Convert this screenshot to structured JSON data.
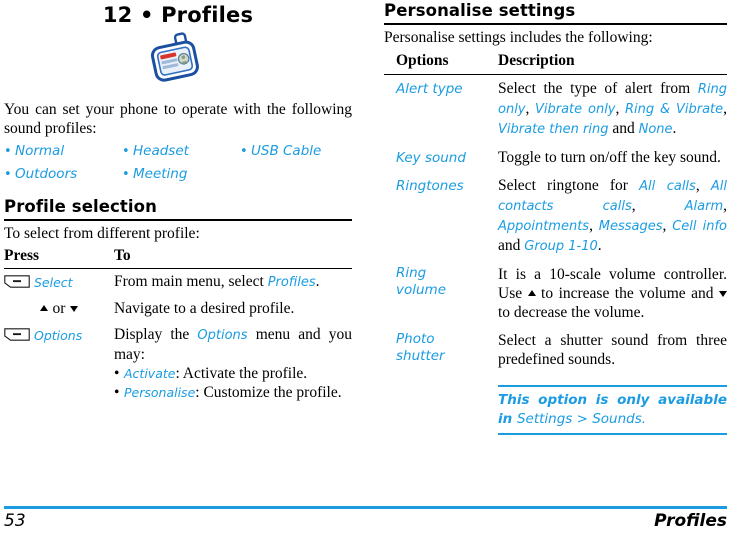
{
  "document": {
    "chapter_title": "12 • Profiles",
    "icon": "id-badge-icon",
    "accent_color": "#1b9ce2",
    "text_color": "#000000"
  },
  "left_column": {
    "intro": "You can set your phone to operate with the following sound profiles:",
    "profiles": [
      [
        "Normal",
        "Headset",
        "USB Cable"
      ],
      [
        "Outdoors",
        "Meeting",
        ""
      ]
    ],
    "section": {
      "heading": "Profile selection",
      "intro": "To select from different profile:",
      "table": {
        "headers": [
          "Press",
          "To"
        ],
        "rows": [
          {
            "press_type": "softkey",
            "press_key_label": "Select",
            "to_prefix": "From main menu, select ",
            "to_blue": "Profiles",
            "to_suffix": "."
          },
          {
            "press_type": "navigate",
            "press_or": "or",
            "to_text": "Navigate to a desired profile."
          },
          {
            "press_type": "softkey",
            "press_key_label": "Options",
            "to_prefix": "Display the ",
            "to_blue": "Options",
            "to_suffix": " menu and you may:",
            "sub_items": [
              {
                "label": "Activate",
                "text": ": Activate the profile."
              },
              {
                "label": "Personalise",
                "text": ": Customize the profile."
              }
            ]
          }
        ]
      }
    }
  },
  "right_column": {
    "heading": "Personalise settings",
    "intro": "Personalise settings includes the following:",
    "table": {
      "headers": [
        "Options",
        "Description"
      ],
      "rows": [
        {
          "option": "Alert type",
          "segments": [
            {
              "t": "Select the type of alert from ",
              "blue": false
            },
            {
              "t": "Ring only",
              "blue": true
            },
            {
              "t": ", ",
              "blue": false
            },
            {
              "t": "Vibrate only",
              "blue": true
            },
            {
              "t": ", ",
              "blue": false
            },
            {
              "t": "Ring & Vibrate",
              "blue": true
            },
            {
              "t": ", ",
              "blue": false
            },
            {
              "t": "Vibrate then ring",
              "blue": true
            },
            {
              "t": " and ",
              "blue": false
            },
            {
              "t": "None",
              "blue": true
            },
            {
              "t": ".",
              "blue": false
            }
          ]
        },
        {
          "option": "Key sound",
          "segments": [
            {
              "t": "Toggle to turn on/off the key sound.",
              "blue": false
            }
          ]
        },
        {
          "option": "Ringtones",
          "segments": [
            {
              "t": "Select ringtone for ",
              "blue": false
            },
            {
              "t": "All calls",
              "blue": true
            },
            {
              "t": ", ",
              "blue": false
            },
            {
              "t": "All contacts calls",
              "blue": true
            },
            {
              "t": ", ",
              "blue": false
            },
            {
              "t": "Alarm",
              "blue": true
            },
            {
              "t": ", ",
              "blue": false
            },
            {
              "t": "Appointments",
              "blue": true
            },
            {
              "t": ", ",
              "blue": false
            },
            {
              "t": "Messages",
              "blue": true
            },
            {
              "t": ", ",
              "blue": false
            },
            {
              "t": "Cell info",
              "blue": true
            },
            {
              "t": " and ",
              "blue": false
            },
            {
              "t": "Group 1-10",
              "blue": true
            },
            {
              "t": ".",
              "blue": false
            }
          ]
        },
        {
          "option": "Ring volume",
          "volume_text_1": "It is a 10-scale volume controller. Use ",
          "volume_text_2": " to increase the volume and ",
          "volume_text_3": " to decrease the volume.",
          "segments": []
        },
        {
          "option": "Photo shutter",
          "segments": [
            {
              "t": "Select a shutter sound from three predefined sounds.",
              "blue": false
            }
          ]
        }
      ]
    },
    "note": {
      "bold_part": "This option is only available in ",
      "rest_part": "Settings > Sounds."
    }
  },
  "footer": {
    "page_number": "53",
    "chapter_name": "Profiles"
  }
}
